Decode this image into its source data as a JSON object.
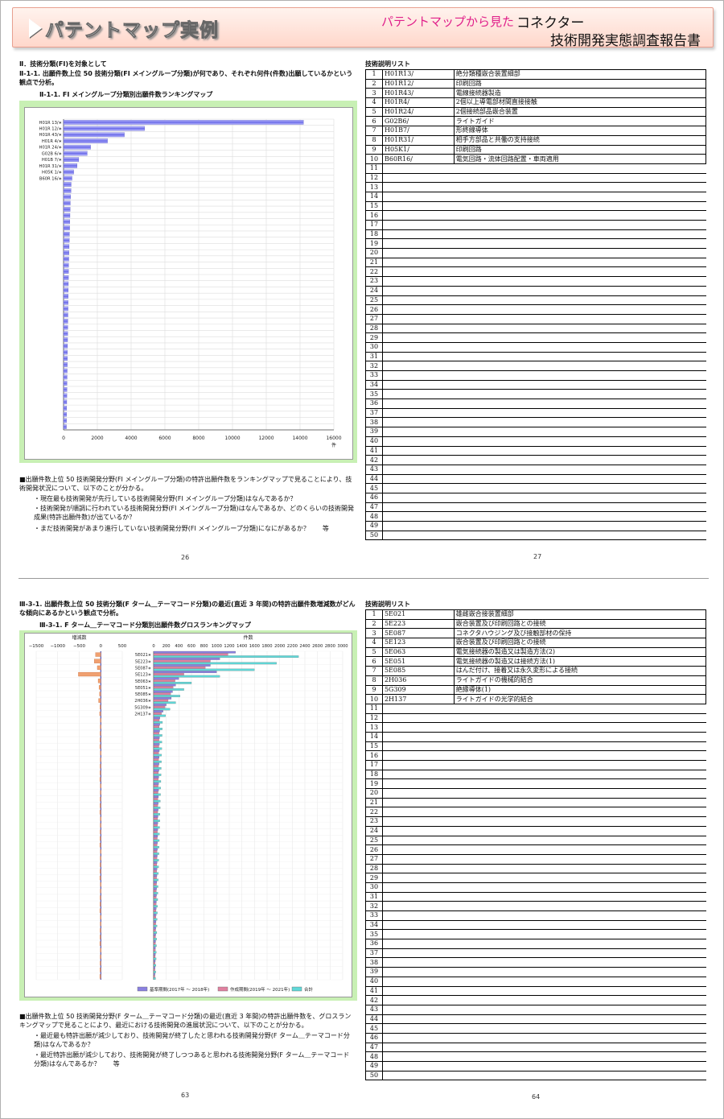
{
  "header": {
    "title": "パテントマップ実例",
    "subtitle": "パテントマップから見た",
    "main": "コネクター",
    "report": "技術開発実態調査報告書"
  },
  "page26": {
    "section": "Ⅱ．技術分類(FI)を対象として",
    "heading": "Ⅱ-1-1. 出願件数上位 50 技術分類(FI メイングループ分類)が何であり、それぞれ何件(件数)出願しているかという観点で分析。",
    "chart_title": "Ⅱ-1-1. FI メイングループ分類別出願件数ランキングマップ",
    "bullet": "■出願件数上位 50 技術開発分野(FI メイングループ分類)の特許出願件数をランキングマップで見ることにより、技術開発状況について、以下のことが分かる。",
    "points": [
      "・現在最も技術開発が先行している技術開発分野(FI メイングループ分類)はなんであるか？",
      "・技術開発が順調に行われている技術開発分野(FI メイングループ分類)はなんであるか、どのくらいの技術開発成果(特許出願件数)が出ているか？",
      "・まだ技術開発があまり進行していない技術開発分野(FI メイングループ分類)になにがあるか？　　等"
    ],
    "page": "26"
  },
  "page27": {
    "list_title": "技術説明リスト",
    "page": "27"
  },
  "page63": {
    "heading": "Ⅲ-3-1. 出願件数上位 50 技術分類(F ターム＿テーマコード分類)の最近(直近 3 年間)の特許出願件数増減数がどんな傾向にあるかという観点で分析。",
    "chart_title": "Ⅲ-3-1. F ターム＿テーマコード分類別出願件数グロスランキングマップ",
    "bullet": "■出願件数上位 50 技術開発分野(F ターム＿テーマコード分類)の最近(直近 3 年間)の特許出願件数を、グロスランキングマップで見ることにより、最近における技術開発の進展状況について、以下のことが分かる。",
    "points": [
      "・最近最も特許出願が減少しており、技術開発が終了したと思われる技術開発分野(F ターム＿テーマコード分類)はなんであるか？",
      "・最近特許出願が減少しており、技術開発が終了しつつあると思われる技術開発分野(F ターム＿テーマコード分類)はなんであるか？　　等"
    ],
    "page": "63"
  },
  "page64": {
    "list_title": "技術説明リスト",
    "page": "64"
  },
  "table1": [
    {
      "n": "1",
      "code": "H01R13/",
      "desc": "絶分類種嵌合装置細部"
    },
    {
      "n": "2",
      "code": "H01R12/",
      "desc": "印刷回路"
    },
    {
      "n": "3",
      "code": "H01R43/",
      "desc": "電線接続器製造"
    },
    {
      "n": "4",
      "code": "H01R4/",
      "desc": "2個以上導電部材間直接接触"
    },
    {
      "n": "5",
      "code": "H01R24/",
      "desc": "2個接続部品嵌合装置"
    },
    {
      "n": "6",
      "code": "G02B6/",
      "desc": "ライトガイド"
    },
    {
      "n": "7",
      "code": "H01B7/",
      "desc": "形終線導体"
    },
    {
      "n": "8",
      "code": "H01R31/",
      "desc": "相手方部品と共働の支持接続"
    },
    {
      "n": "9",
      "code": "H05K1/",
      "desc": "印刷回路"
    },
    {
      "n": "10",
      "code": "B60R16/",
      "desc": "電気回路・流体回路配置・車両適用"
    }
  ],
  "table2": [
    {
      "n": "1",
      "code": "5E021",
      "desc": "雄雌嵌合接装置細部"
    },
    {
      "n": "2",
      "code": "5E223",
      "desc": "嵌合装置及び印刷回路との接続"
    },
    {
      "n": "3",
      "code": "5E087",
      "desc": "コネクタハウジング及び接触部材の保持"
    },
    {
      "n": "4",
      "code": "5E123",
      "desc": "嵌合装置及び印刷回路との接続"
    },
    {
      "n": "5",
      "code": "5E063",
      "desc": "電気接続器の製造又は製造方法(2)"
    },
    {
      "n": "6",
      "code": "5E051",
      "desc": "電気接続器の製造又は接続方法(1)"
    },
    {
      "n": "7",
      "code": "5E085",
      "desc": "はんだ付け、接着又は永久変形による接続"
    },
    {
      "n": "8",
      "code": "2H036",
      "desc": "ライトガイドの機械的結合"
    },
    {
      "n": "9",
      "code": "5G309",
      "desc": "絶縁導体(1)"
    },
    {
      "n": "10",
      "code": "2H137",
      "desc": "ライトガイドの光学的結合"
    }
  ],
  "chart_data": [
    {
      "type": "bar",
      "orientation": "horizontal",
      "title": "Ⅱ-1-1. FI メイングループ分類別出願件数ランキングマップ",
      "categories": [
        "H01R 13/∗",
        "H01R 12/∗",
        "H01R 43/∗",
        "H01R 4/∗",
        "H01R 24/∗",
        "G02B 6/∗",
        "H01B 7/∗",
        "H01R 31/∗",
        "H05K 1/∗",
        "B60R 16/∗"
      ],
      "values": [
        14200,
        4800,
        3600,
        2600,
        1600,
        1400,
        900,
        800,
        600,
        500
      ],
      "tail_values": [
        450,
        440,
        420,
        400,
        390,
        380,
        370,
        360,
        350,
        340,
        330,
        320,
        310,
        300,
        295,
        290,
        285,
        280,
        275,
        270,
        265,
        260,
        255,
        250,
        245,
        240,
        235,
        230,
        225,
        220,
        215,
        210,
        205,
        200,
        195,
        190,
        185,
        180,
        175,
        170
      ],
      "xlim": [
        0,
        16000
      ],
      "xticks": [
        "0",
        "2000",
        "4000",
        "6000",
        "8000",
        "10000",
        "12000",
        "14000",
        "16000"
      ],
      "xunit": "件"
    },
    {
      "type": "bar",
      "orientation": "horizontal",
      "title": "Ⅲ-3-1. F ターム＿テーマコード分類別出願件数グロスランキングマップ",
      "categories": [
        "5E021∗",
        "5E223∗",
        "5E087∗",
        "5E123∗",
        "5E063∗",
        "5E051∗",
        "5E085∗",
        "2H036∗",
        "5G309∗",
        "2H137∗"
      ],
      "left_title": "増減数",
      "left_xlim": [
        -1500,
        500
      ],
      "left_xticks": [
        "−1500",
        "−1000",
        "−500",
        "0",
        "500"
      ],
      "right_title": "件数",
      "right_xlim": [
        0,
        3000
      ],
      "right_xticks": [
        "0",
        "200",
        "400",
        "600",
        "800",
        "1000",
        "1200",
        "1400",
        "1600",
        "1800",
        "2000",
        "2200",
        "2400",
        "2600",
        "2800",
        "3000"
      ],
      "change": [
        -120,
        -150,
        -80,
        -520,
        -60,
        -40,
        -30,
        -50,
        -20,
        -25
      ],
      "series": [
        {
          "name": "基準期間(2017年 ～ 2018年)",
          "values": [
            1300,
            1050,
            900,
            1000,
            400,
            350,
            300,
            280,
            200,
            150
          ],
          "color": "#8a80e0"
        },
        {
          "name": "作成期間(2019年 ～ 2021年)",
          "values": [
            1180,
            900,
            820,
            480,
            340,
            310,
            270,
            230,
            180,
            125
          ],
          "color": "#e080a0"
        },
        {
          "name": "合計",
          "values": [
            2300,
            1950,
            1600,
            1050,
            600,
            480,
            420,
            350,
            260,
            190
          ],
          "color": "#60d8d8"
        }
      ],
      "tail_count": 40
    }
  ]
}
